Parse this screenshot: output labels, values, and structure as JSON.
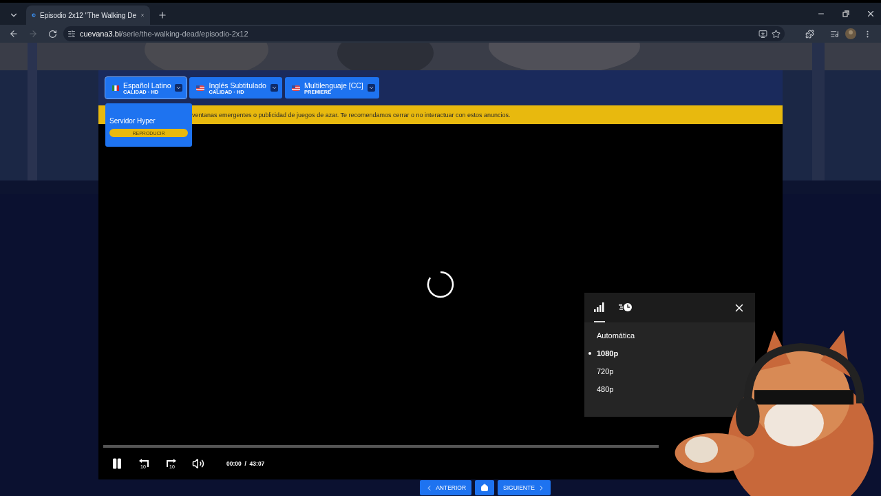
{
  "browser": {
    "tab_title": "Episodio 2x12 \"The Walking De",
    "url_host": "cuevana3.bi",
    "url_path": "/serie/the-walking-dead/episodio-2x12"
  },
  "languages": [
    {
      "label": "Español Latino",
      "quality": "CALIDAD · HD",
      "selected": true
    },
    {
      "label": "Inglés Subtitulado",
      "quality": "CALIDAD · HD",
      "selected": false
    },
    {
      "label": "Multilenguaje [CC]",
      "quality": "PREMIERE",
      "selected": false
    }
  ],
  "server_popup": {
    "title": "Servidor Hyper",
    "button": "REPRODUCIR"
  },
  "banner": {
    "text": "ventanas emergentes o publicidad de juegos de azar. Te recomendamos cerrar o no interactuar con estos anuncios."
  },
  "quality_menu": {
    "tabs": [
      {
        "kind": "quality",
        "selected": true
      },
      {
        "kind": "speed",
        "selected": false
      }
    ],
    "options": [
      {
        "label": "Automática",
        "selected": false
      },
      {
        "label": "1080p",
        "selected": true
      },
      {
        "label": "720p",
        "selected": false
      },
      {
        "label": "480p",
        "selected": false
      }
    ]
  },
  "player": {
    "rewind_label": "10",
    "forward_label": "10",
    "current_time": "00:00",
    "separator": "/",
    "duration": "43:07",
    "loading": true
  },
  "nav": {
    "previous": "ANTERIOR",
    "next": "SIGUIENTE"
  }
}
